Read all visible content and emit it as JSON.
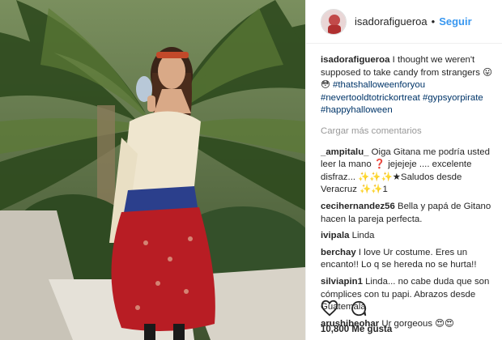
{
  "post": {
    "username": "isadorafigueroa",
    "separator": "•",
    "follow_label": "Seguir",
    "caption": {
      "username": "isadorafigueroa",
      "text": " I thought we weren't supposed to take candy from strangers 😛 😳 ",
      "hashtags": [
        "#thatshalloweenforyou",
        "#nevertooldtotrickortreat",
        "#gypsyorpirate",
        "#happyhalloween"
      ]
    },
    "load_more_label": "Cargar más comentarios",
    "comments": [
      {
        "username": "_ampitalu_",
        "text": " Oiga Gitana me podría usted leer la mano ❓ jejejeje .... excelente disfraz... ✨✨✨★Saludos desde Veracruz ✨✨1"
      },
      {
        "username": "cecihernandez56",
        "text": " Bella y papá de Gitano hacen la pareja perfecta."
      },
      {
        "username": "ivipala",
        "text": " Linda"
      },
      {
        "username": "berchay",
        "text": " I love Ur costume. Eres un encanto!! Lo q se hereda no se hurta!!"
      },
      {
        "username": "silviapin1",
        "text": " Linda... no cabe duda que son cómplices con tu papi. Abrazos desde Guatemala"
      },
      {
        "username": "arushibeohar",
        "text": " Ur gorgeous 😍😍"
      }
    ],
    "likes_label": "10,800 Me gusta",
    "icons": {
      "like": "heart-icon",
      "comment": "comment-bubble-icon"
    },
    "colors": {
      "link": "#3897f0",
      "hashtag": "#003569",
      "muted": "#999999"
    }
  }
}
